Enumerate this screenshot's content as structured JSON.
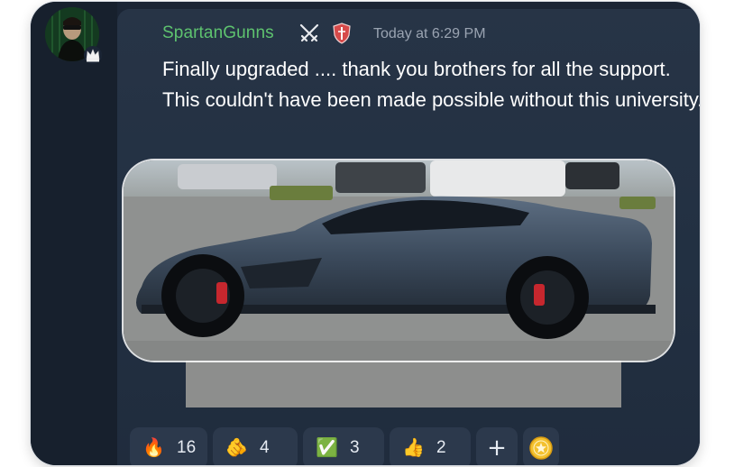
{
  "message": {
    "author": "SpartanGunns",
    "timestamp": "Today at 6:29 PM",
    "text": "Finally upgraded .... thank you brothers for all the support. This couldn't have been made possible without this university."
  },
  "reactions": [
    {
      "emoji": "🔥",
      "icon": "fire-icon",
      "count": "16"
    },
    {
      "emoji": "🫵",
      "icon": "pointing-hand-icon",
      "count": "4"
    },
    {
      "emoji": "✅",
      "icon": "check-mark-icon",
      "count": "3"
    },
    {
      "emoji": "👍",
      "icon": "thumbs-up-icon",
      "count": "2"
    }
  ],
  "add_reaction_label": "+",
  "colors": {
    "username": "#5ec36f",
    "timestamp": "#9aa4b2",
    "panel": "#223042",
    "reaction_bg": "#2c394c"
  }
}
